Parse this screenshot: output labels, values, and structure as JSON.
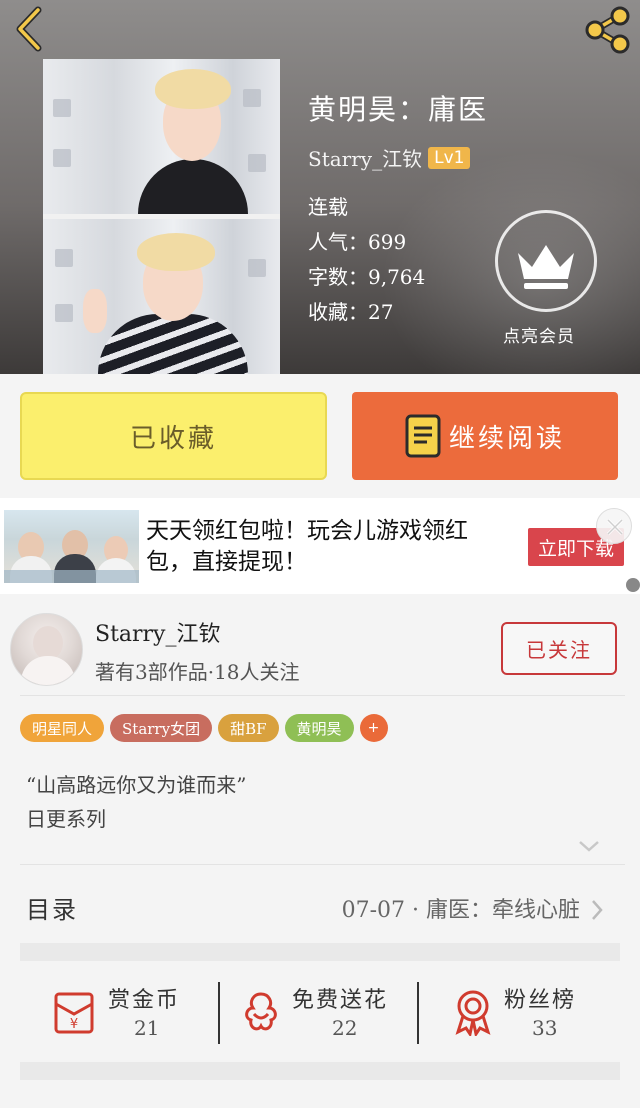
{
  "header": {
    "title": "黄明昊：庸医",
    "author": "Starry_江钦",
    "level": "Lv1",
    "status": "连载",
    "popularity": "人气：699",
    "word_count": "字数：9,764",
    "favorites": "收藏：27",
    "vip_label": "点亮会员",
    "icons": {
      "back": "chevron-left-icon",
      "share": "share-icon",
      "vip": "crown-icon"
    }
  },
  "actions": {
    "collect_label": "已收藏",
    "read_label": "继续阅读",
    "colors": {
      "collect": "#fbef6d",
      "read": "#ec6b3c"
    }
  },
  "ad": {
    "text": "天天领红包啦！玩会儿游戏领红包，直接提现！",
    "cta": "立即下载"
  },
  "author_card": {
    "name": "Starry_江钦",
    "meta": "著有3部作品·18人关注",
    "follow_label": "已关注",
    "tags": [
      {
        "label": "明星同人",
        "color": "#f0a43a"
      },
      {
        "label": "Starry女团",
        "color": "#c86d5f"
      },
      {
        "label": "甜BF",
        "color": "#d9a13e"
      },
      {
        "label": "黄明昊",
        "color": "#8fbf55"
      }
    ],
    "more_tag": "+",
    "description_line1": "“山高路远你又为谁而来”",
    "description_line2": "日更系列"
  },
  "catalog": {
    "label": "目录",
    "latest": "07-07 · 庸医：牵线心脏"
  },
  "rewards": [
    {
      "label": "赏金币",
      "count": "21",
      "icon": "red-envelope-icon"
    },
    {
      "label": "免费送花",
      "count": "22",
      "icon": "flower-icon"
    },
    {
      "label": "粉丝榜",
      "count": "33",
      "icon": "medal-icon"
    }
  ]
}
